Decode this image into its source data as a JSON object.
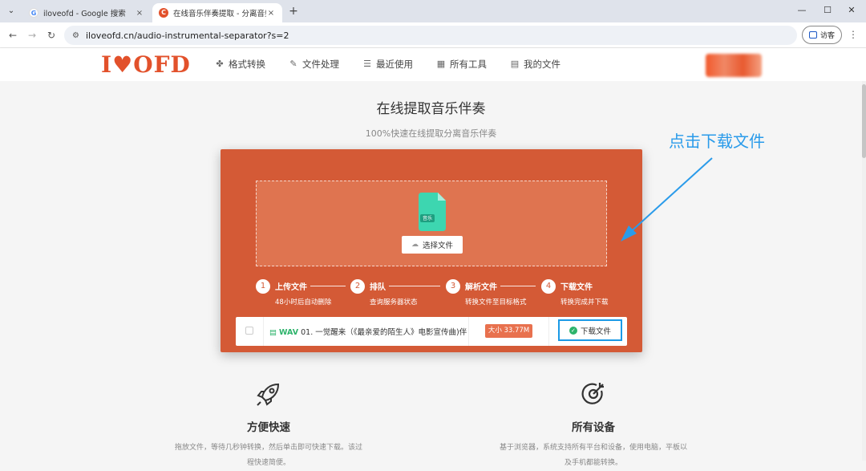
{
  "browser": {
    "tabs": [
      {
        "title": "iloveofd - Google 搜索",
        "active": false
      },
      {
        "title": "在线音乐伴奏提取 - 分离音频人",
        "active": true
      }
    ],
    "url": "iloveofd.cn/audio-instrumental-separator?s=2",
    "guest_label": "访客",
    "new_tab": "+",
    "close": "×"
  },
  "header": {
    "logo": "I♥OFD",
    "nav": [
      {
        "label": "格式转换",
        "icon": "puzzle-icon"
      },
      {
        "label": "文件处理",
        "icon": "file-edit-icon"
      },
      {
        "label": "最近使用",
        "icon": "history-icon"
      },
      {
        "label": "所有工具",
        "icon": "grid-icon"
      },
      {
        "label": "我的文件",
        "icon": "document-icon"
      }
    ]
  },
  "main": {
    "title": "在线提取音乐伴奏",
    "subtitle": "100%快速在线提取分离音乐伴奏",
    "file_icon_label": "音乐",
    "choose_button": "选择文件",
    "steps": [
      {
        "num": "1",
        "title": "上传文件",
        "desc": "48小时后自动删除"
      },
      {
        "num": "2",
        "title": "排队",
        "desc": "查询服务器状态"
      },
      {
        "num": "3",
        "title": "解析文件",
        "desc": "转换文件至目标格式"
      },
      {
        "num": "4",
        "title": "下载文件",
        "desc": "转换完成并下载"
      }
    ],
    "file": {
      "ext": "WAV",
      "name": "01. 一觉醒来（《最亲爱的陌生人》电影宣传曲)伴",
      "size": "大小 33.77M",
      "download": "下载文件"
    }
  },
  "annotation": {
    "text": "点击下载文件",
    "color": "#2a9bea"
  },
  "features": [
    {
      "icon": "rocket-icon",
      "title": "方便快速",
      "desc": "拖放文件，等待几秒钟转换，然后单击即可快速下载。该过程快速简便。"
    },
    {
      "icon": "target-icon",
      "title": "所有设备",
      "desc": "基于浏览器，系统支持所有平台和设备，使用电脑，平板以及手机都能转换。"
    }
  ],
  "colors": {
    "brand": "#e2512b",
    "panel": "#d45a36",
    "success": "#2db36b",
    "highlight": "#1b9ae6"
  }
}
